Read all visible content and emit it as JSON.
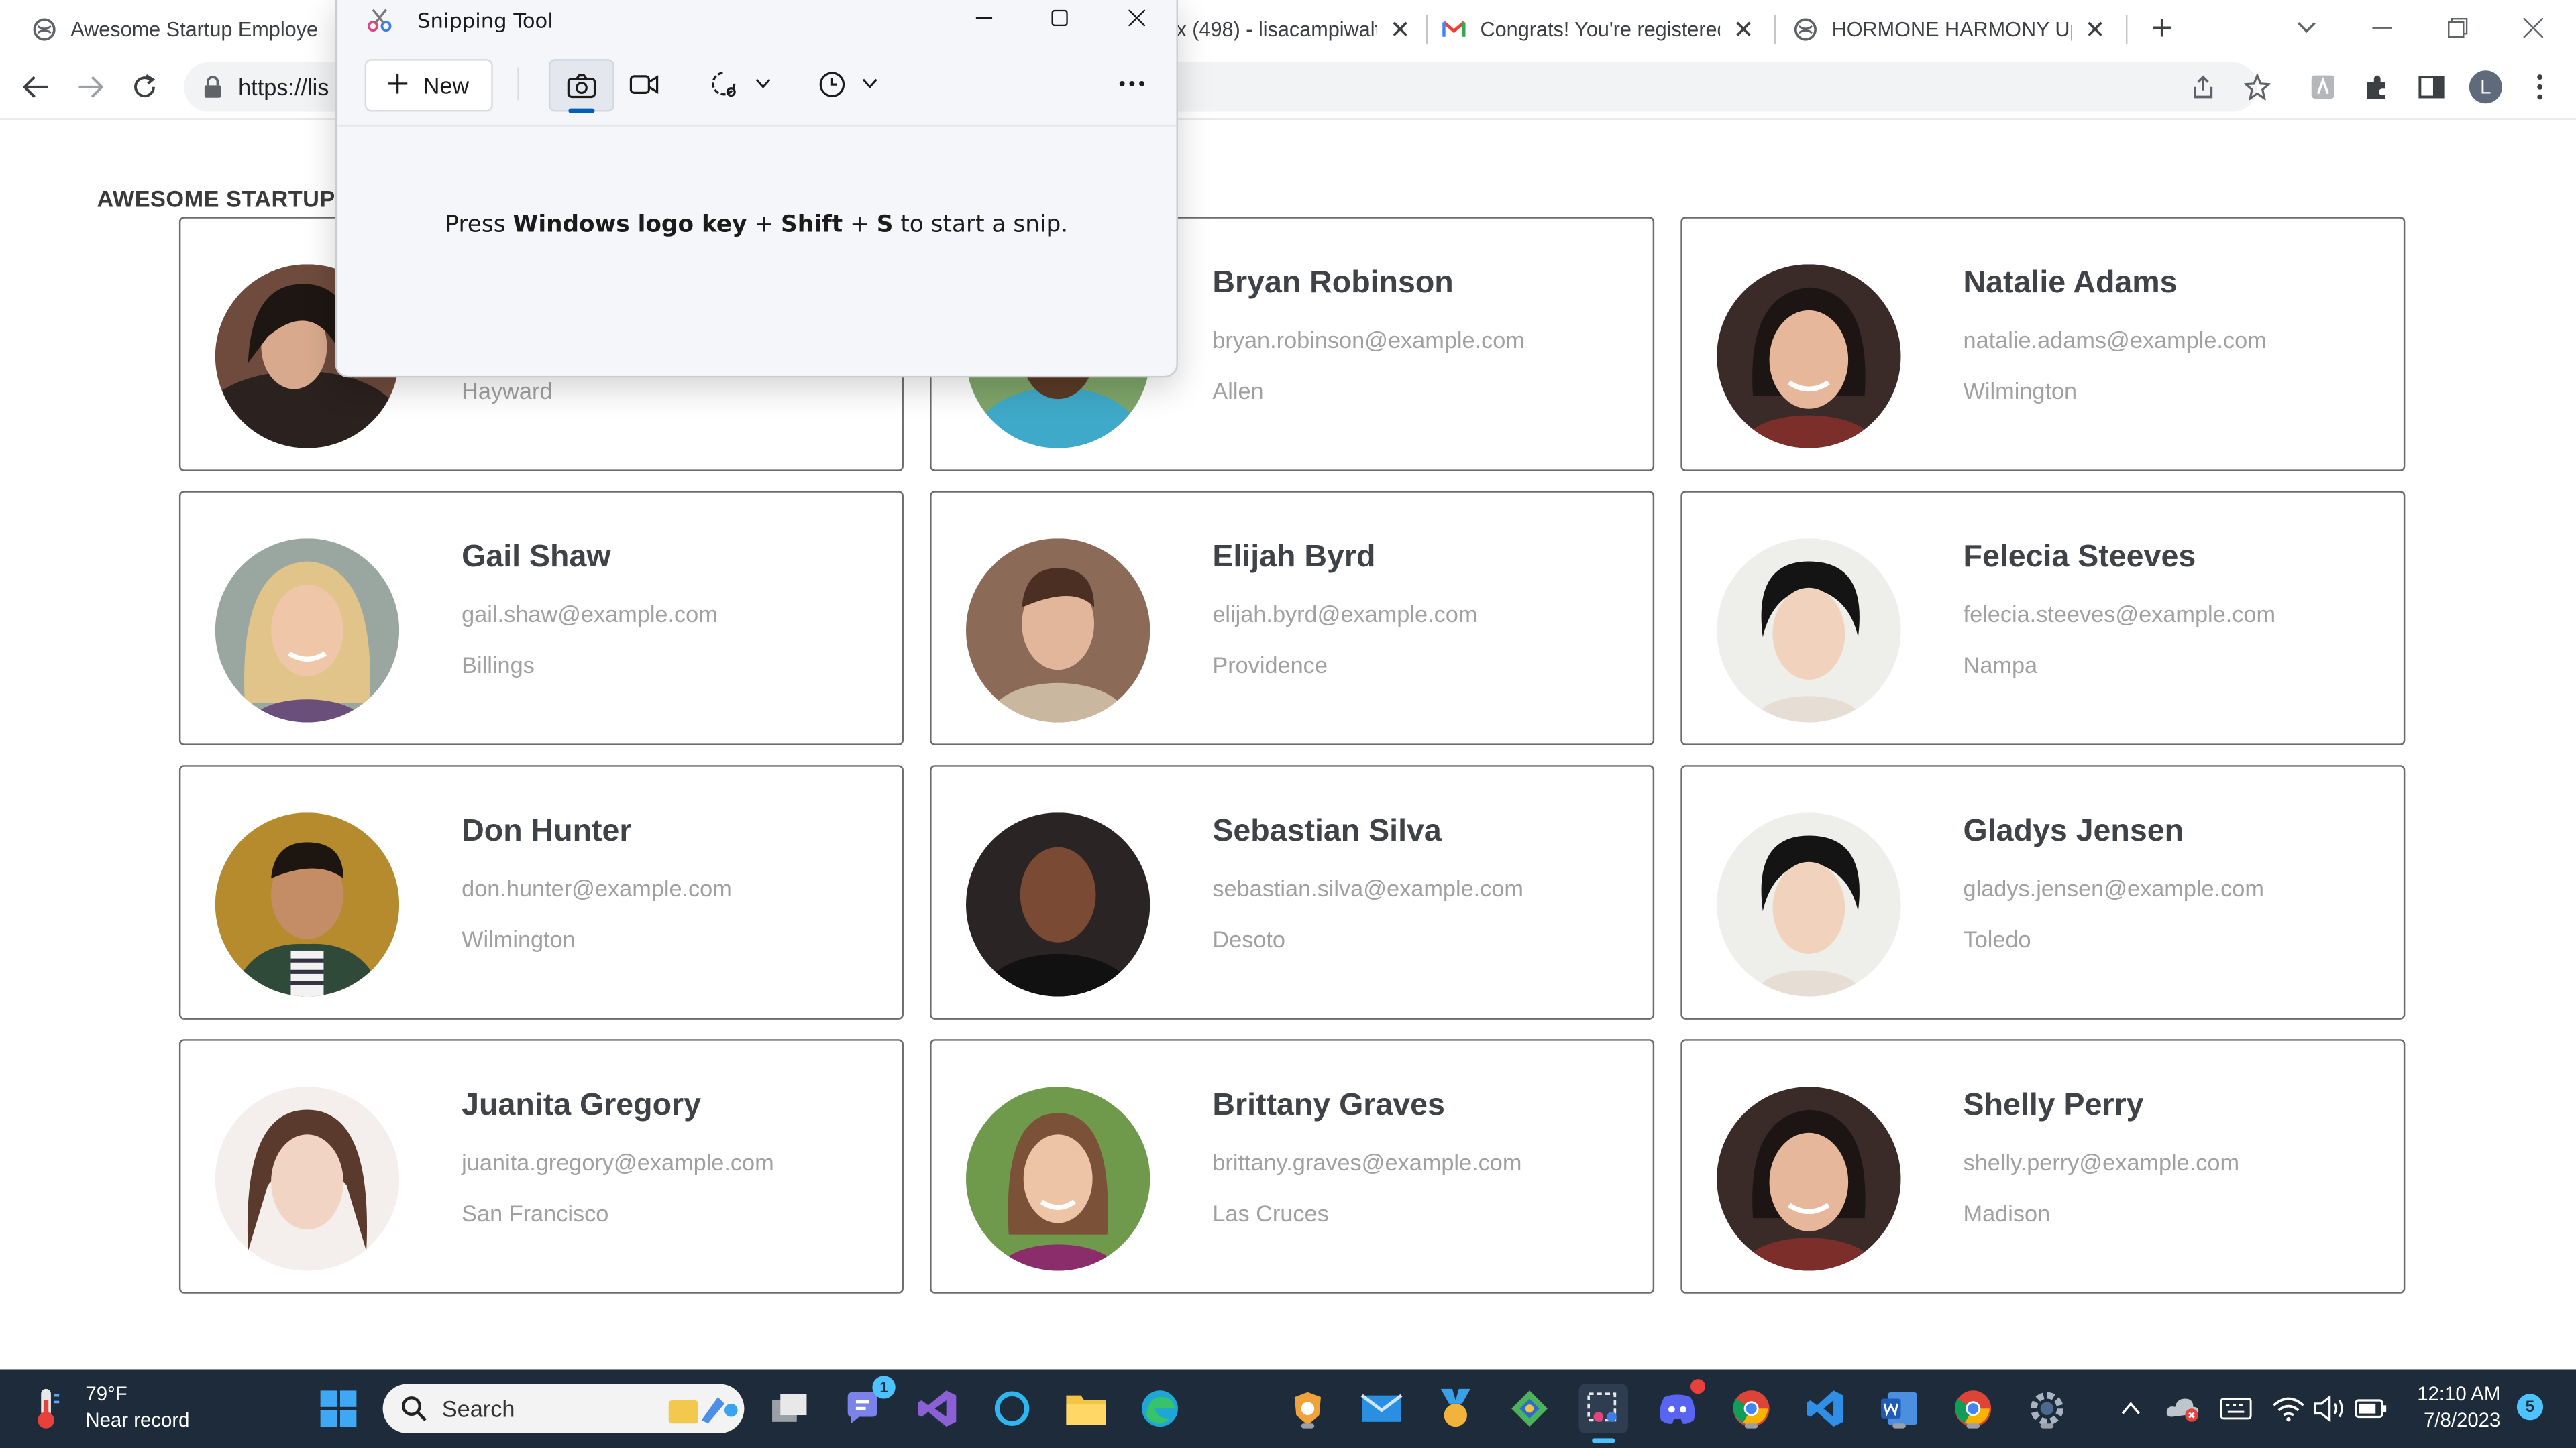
{
  "browser": {
    "tabs": [
      {
        "title": "Awesome Startup Employe",
        "close": "✕"
      },
      {
        "title": "x (498) - lisacampiwalte",
        "close": "✕"
      },
      {
        "title": "Congrats! You're registered",
        "close": "✕"
      },
      {
        "title": "HORMONE HARMONY Upc",
        "close": "✕"
      }
    ],
    "new_tab": "+",
    "url": "https://lis",
    "profile_initial": "L"
  },
  "page": {
    "heading": "AWESOME STARTUP",
    "employees": [
      {
        "name": "",
        "email": "",
        "city": "Hayward"
      },
      {
        "name": "Bryan Robinson",
        "email": "bryan.robinson@example.com",
        "city": "Allen"
      },
      {
        "name": "Natalie Adams",
        "email": "natalie.adams@example.com",
        "city": "Wilmington"
      },
      {
        "name": "Gail Shaw",
        "email": "gail.shaw@example.com",
        "city": "Billings"
      },
      {
        "name": "Elijah Byrd",
        "email": "elijah.byrd@example.com",
        "city": "Providence"
      },
      {
        "name": "Felecia Steeves",
        "email": "felecia.steeves@example.com",
        "city": "Nampa"
      },
      {
        "name": "Don Hunter",
        "email": "don.hunter@example.com",
        "city": "Wilmington"
      },
      {
        "name": "Sebastian Silva",
        "email": "sebastian.silva@example.com",
        "city": "Desoto"
      },
      {
        "name": "Gladys Jensen",
        "email": "gladys.jensen@example.com",
        "city": "Toledo"
      },
      {
        "name": "Juanita Gregory",
        "email": "juanita.gregory@example.com",
        "city": "San Francisco"
      },
      {
        "name": "Brittany Graves",
        "email": "brittany.graves@example.com",
        "city": "Las Cruces"
      },
      {
        "name": "Shelly Perry",
        "email": "shelly.perry@example.com",
        "city": "Madison"
      }
    ]
  },
  "snipping_tool": {
    "title": "Snipping Tool",
    "new_label": "New",
    "message_pre": "Press ",
    "message_key1": "Windows logo key",
    "message_plus1": " + ",
    "message_key2": "Shift",
    "message_plus2": " + ",
    "message_key3": "S",
    "message_post": " to start a snip."
  },
  "taskbar": {
    "temperature": "79°F",
    "weather_text": "Near record",
    "search_label": "Search",
    "time": "12:10 AM",
    "date": "7/8/2023",
    "notification_count": "5",
    "teams_badge": "1"
  }
}
